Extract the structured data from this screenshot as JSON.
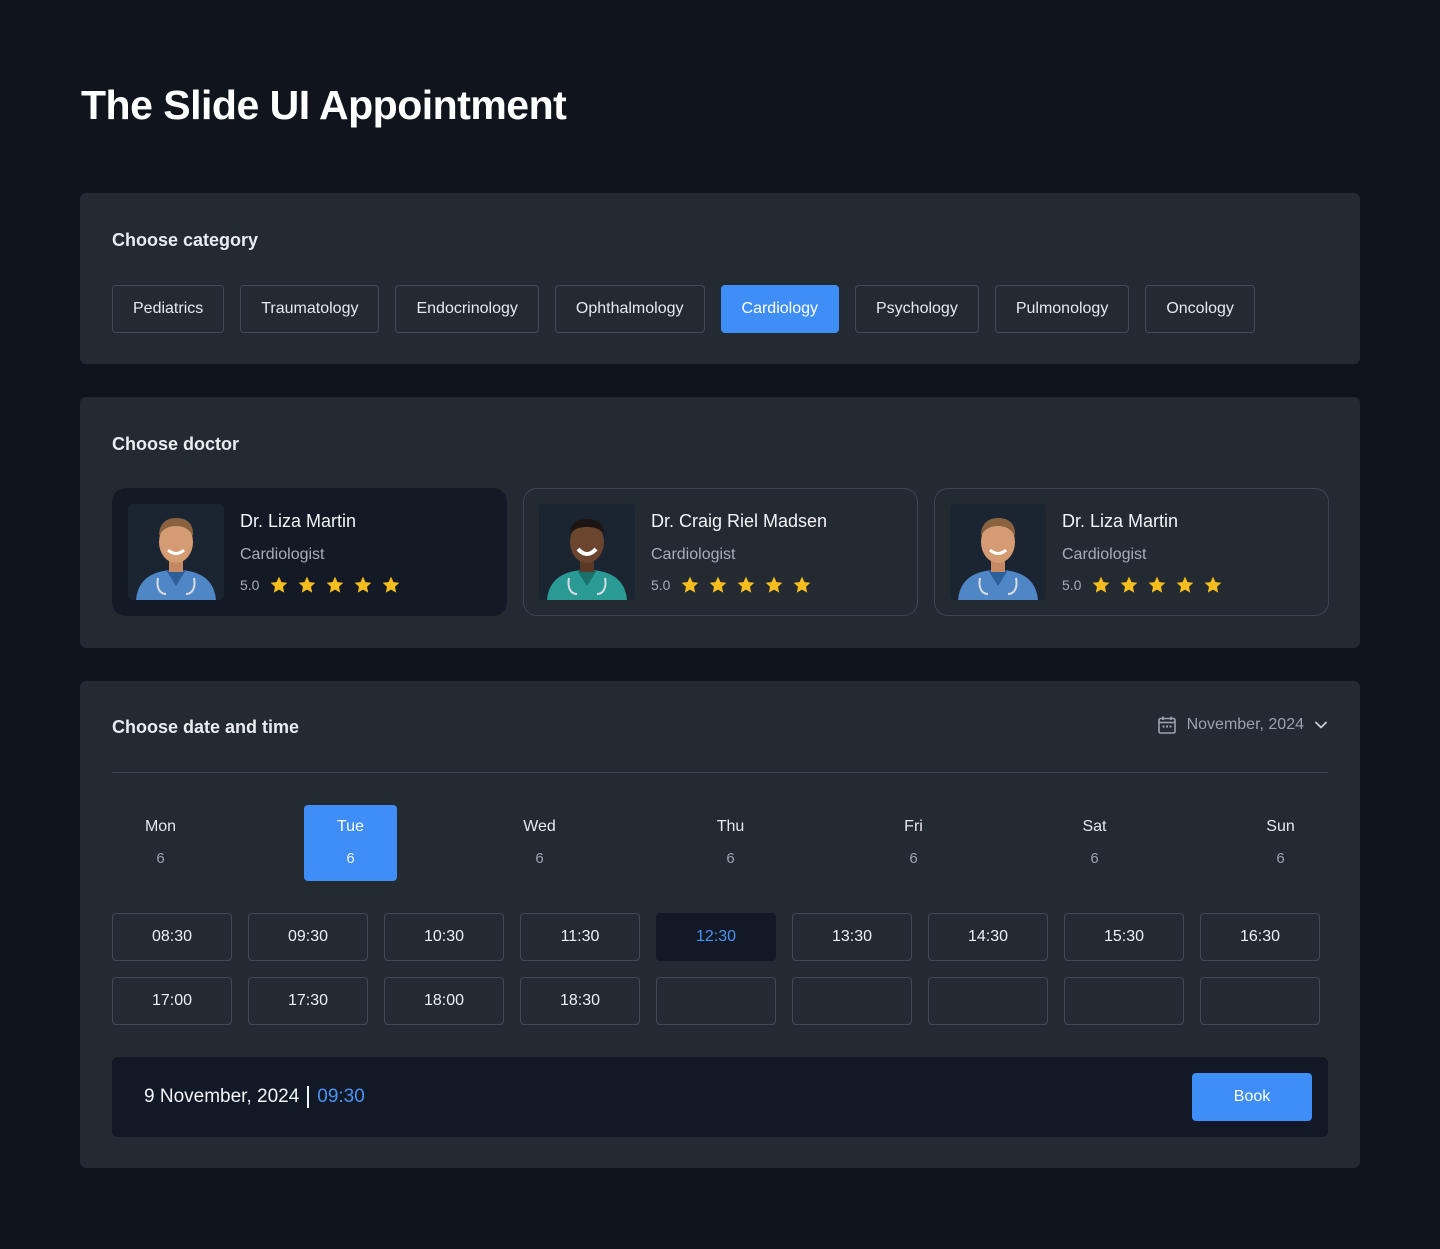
{
  "page": {
    "title": "The Slide UI Appointment"
  },
  "category": {
    "title": "Choose category",
    "items": [
      {
        "label": "Pediatrics",
        "active": false
      },
      {
        "label": "Traumatology",
        "active": false
      },
      {
        "label": "Endocrinology",
        "active": false
      },
      {
        "label": "Ophthalmology",
        "active": false
      },
      {
        "label": "Cardiology",
        "active": true
      },
      {
        "label": "Psychology",
        "active": false
      },
      {
        "label": "Pulmonology",
        "active": false
      },
      {
        "label": "Oncology",
        "active": false
      }
    ]
  },
  "doctor": {
    "title": "Choose doctor",
    "cards": [
      {
        "name": "Dr. Liza Martin",
        "specialty": "Cardiologist",
        "rating": "5.0",
        "stars": 5,
        "active": true
      },
      {
        "name": "Dr. Craig Riel Madsen",
        "specialty": "Cardiologist",
        "rating": "5.0",
        "stars": 5,
        "active": false
      },
      {
        "name": "Dr. Liza Martin",
        "specialty": "Cardiologist",
        "rating": "5.0",
        "stars": 5,
        "active": false
      }
    ]
  },
  "datetime": {
    "title": "Choose date and time",
    "month": "November, 2024",
    "days": [
      {
        "name": "Mon",
        "num": "6",
        "active": false
      },
      {
        "name": "Tue",
        "num": "6",
        "active": true
      },
      {
        "name": "Wed",
        "num": "6",
        "active": false
      },
      {
        "name": "Thu",
        "num": "6",
        "active": false
      },
      {
        "name": "Fri",
        "num": "6",
        "active": false
      },
      {
        "name": "Sat",
        "num": "6",
        "active": false
      },
      {
        "name": "Sun",
        "num": "6",
        "active": false
      }
    ],
    "slots": [
      {
        "time": "08:30",
        "active": false
      },
      {
        "time": "09:30",
        "active": false
      },
      {
        "time": "10:30",
        "active": false
      },
      {
        "time": "11:30",
        "active": false
      },
      {
        "time": "12:30",
        "active": true
      },
      {
        "time": "13:30",
        "active": false
      },
      {
        "time": "14:30",
        "active": false
      },
      {
        "time": "15:30",
        "active": false
      },
      {
        "time": "16:30",
        "active": false
      },
      {
        "time": "17:00",
        "active": false
      },
      {
        "time": "17:30",
        "active": false
      },
      {
        "time": "18:00",
        "active": false
      },
      {
        "time": "18:30",
        "active": false
      },
      {
        "time": "",
        "active": false
      },
      {
        "time": "",
        "active": false
      },
      {
        "time": "",
        "active": false
      },
      {
        "time": "",
        "active": false
      },
      {
        "time": "",
        "active": false
      }
    ]
  },
  "booking": {
    "date": "9 November, 2024",
    "time": "09:30",
    "button_label": "Book"
  },
  "colors": {
    "accent": "#3f8ef7",
    "star": "#f7bd1c",
    "background": "#0f141d",
    "panel": "#232a32"
  }
}
